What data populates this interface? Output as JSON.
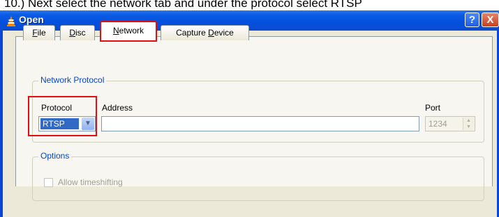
{
  "instruction": "10.) Next select the network tab and under the protocol select RTSP",
  "window": {
    "title": "Open",
    "help_label": "?",
    "close_label": "X"
  },
  "tabs": [
    {
      "label": "File",
      "hotkey": "F",
      "rest": "ile"
    },
    {
      "label": "Disc",
      "hotkey": "D",
      "rest": "isc"
    },
    {
      "label": "Network",
      "hotkey": "N",
      "rest": "etwork"
    },
    {
      "label": "Capture Device",
      "prefix": "Capture ",
      "hotkey": "D",
      "rest": "evice"
    }
  ],
  "active_tab": "Network",
  "network_protocol": {
    "group_label": "Network Protocol",
    "protocol_label": "Protocol",
    "protocol_value": "RTSP",
    "address_label": "Address",
    "address_value": "",
    "port_label": "Port",
    "port_value": "1234"
  },
  "options": {
    "group_label": "Options",
    "timeshift_label": "Allow timeshifting",
    "timeshift_checked": false
  },
  "colors": {
    "highlight_box": "#e01010",
    "title_bar": "#0550de",
    "group_label": "#0046d5",
    "selection": "#316ac5"
  },
  "icons": {
    "app": "vlc-cone-icon",
    "select_arrow": "chevron-down-icon",
    "spinner": "spin-arrows-icon"
  }
}
